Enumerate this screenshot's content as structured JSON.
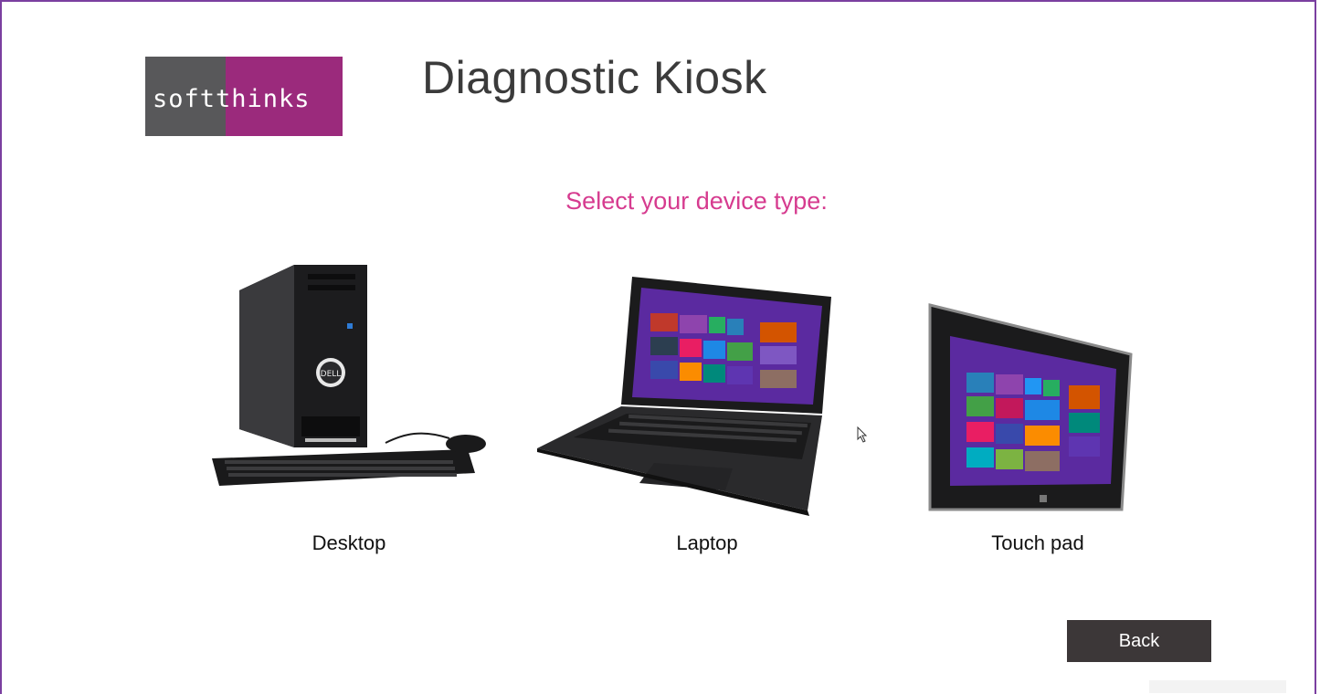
{
  "app": {
    "logo_text": "softthinks",
    "title": "Diagnostic Kiosk"
  },
  "main": {
    "prompt": "Select your device type:",
    "devices": [
      {
        "label": "Desktop",
        "icon": "desktop-computer-icon"
      },
      {
        "label": "Laptop",
        "icon": "laptop-icon"
      },
      {
        "label": "Touch pad",
        "icon": "tablet-icon"
      }
    ]
  },
  "footer": {
    "back_label": "Back"
  },
  "colors": {
    "brand_gray": "#58585a",
    "brand_purple": "#9b2a7c",
    "prompt_pink": "#d63b8f",
    "frame_purple": "#7a3fa0",
    "button_dark": "#3c3738"
  }
}
